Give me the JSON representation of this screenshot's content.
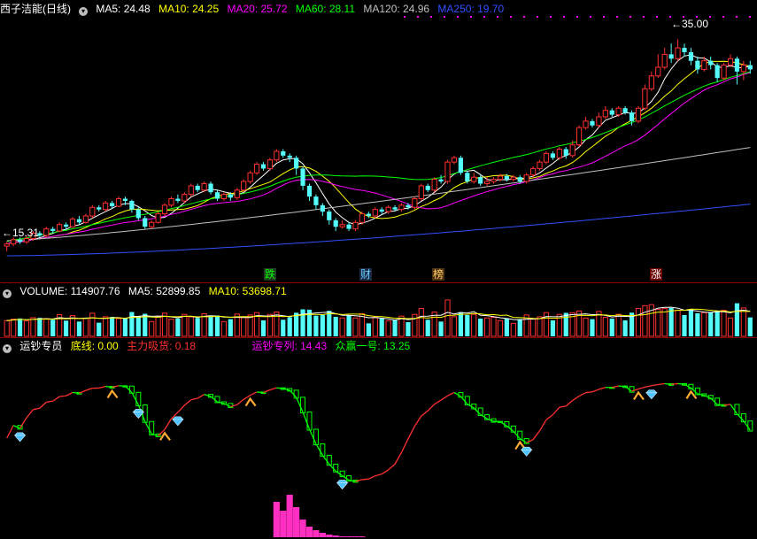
{
  "stock": {
    "name": "西子洁能",
    "period": "(日线)"
  },
  "price_panel": {
    "ma_labels": [
      {
        "text": "MA5: 24.48",
        "color": "#ffffff"
      },
      {
        "text": "MA10: 24.25",
        "color": "#ffff00"
      },
      {
        "text": "MA20: 25.72",
        "color": "#ff00ff"
      },
      {
        "text": "MA60: 28.11",
        "color": "#00ff00"
      },
      {
        "text": "MA120: 24.96",
        "color": "#c0c0c0"
      },
      {
        "text": "MA250: 19.70",
        "color": "#3050ff"
      }
    ],
    "high_label": "35.00",
    "low_label": "15.31",
    "event_tags": [
      {
        "text": "跌",
        "color": "#00ff00",
        "bg": "#1f3a1f"
      },
      {
        "text": "财",
        "color": "#66ccff",
        "bg": "#1c2a44"
      },
      {
        "text": "榜",
        "color": "#ffcc66",
        "bg": "#4a3010"
      },
      {
        "text": "涨",
        "color": "#ffffff",
        "bg": "#6a0000"
      }
    ]
  },
  "volume_panel": {
    "labels": [
      {
        "text": "VOLUME: 114907.76",
        "color": "#ffffff"
      },
      {
        "text": "MA5: 52899.85",
        "color": "#ffffff"
      },
      {
        "text": "MA10: 53698.71",
        "color": "#ffff00"
      }
    ]
  },
  "indicator_panel": {
    "name": "运钞专员",
    "labels": [
      {
        "text": "底线: 0.00",
        "color": "#ffff00"
      },
      {
        "text": "主力吸货: 0.18",
        "color": "#ff3030"
      },
      {
        "text": "运钞专列: 14.43",
        "color": "#ff00ff"
      },
      {
        "text": "众赢一号: 13.25",
        "color": "#00ff00"
      }
    ]
  },
  "colors": {
    "up": "#ff3030",
    "down": "#54fcfc",
    "background": "#000000",
    "separator": "#8b0000"
  },
  "chart_data": {
    "type": "candlestick",
    "candles_approx": [
      [
        15.8,
        16.0,
        15.3,
        16.2
      ],
      [
        16.0,
        16.4,
        15.8,
        16.6
      ],
      [
        16.4,
        16.2,
        16.0,
        16.6
      ],
      [
        16.2,
        16.5,
        16.0,
        16.8
      ],
      [
        16.5,
        17.0,
        16.3,
        17.2
      ],
      [
        17.0,
        16.8,
        16.6,
        17.2
      ],
      [
        16.8,
        17.4,
        16.6,
        17.6
      ],
      [
        17.4,
        17.2,
        17.0,
        17.6
      ],
      [
        17.2,
        17.8,
        17.1,
        18.0
      ],
      [
        17.8,
        17.6,
        17.3,
        18.0
      ],
      [
        17.6,
        18.3,
        17.5,
        18.5
      ],
      [
        18.3,
        18.0,
        17.8,
        18.6
      ],
      [
        18.0,
        18.6,
        17.9,
        18.8
      ],
      [
        18.6,
        19.4,
        18.4,
        19.6
      ],
      [
        19.4,
        19.2,
        19.0,
        19.6
      ],
      [
        19.2,
        19.8,
        19.0,
        20.0
      ],
      [
        19.8,
        19.5,
        19.3,
        20.0
      ],
      [
        19.5,
        20.2,
        19.4,
        20.4
      ],
      [
        20.2,
        20.0,
        19.6,
        20.4
      ],
      [
        20.0,
        19.2,
        18.9,
        20.1
      ],
      [
        19.2,
        18.4,
        18.2,
        19.4
      ],
      [
        18.4,
        17.6,
        17.4,
        18.6
      ],
      [
        17.6,
        18.0,
        17.4,
        18.2
      ],
      [
        18.0,
        18.8,
        17.9,
        19.0
      ],
      [
        18.8,
        19.6,
        18.6,
        19.8
      ],
      [
        19.6,
        20.2,
        19.4,
        20.4
      ],
      [
        20.2,
        20.0,
        19.8,
        20.6
      ],
      [
        20.0,
        20.6,
        19.8,
        20.8
      ],
      [
        20.6,
        21.4,
        20.4,
        21.6
      ],
      [
        21.4,
        21.0,
        20.8,
        21.6
      ],
      [
        21.0,
        21.6,
        20.8,
        21.8
      ],
      [
        21.6,
        20.8,
        20.6,
        21.8
      ],
      [
        20.8,
        20.2,
        20.0,
        21.0
      ],
      [
        20.2,
        20.6,
        20.0,
        20.8
      ],
      [
        20.6,
        20.3,
        20.0,
        20.8
      ],
      [
        20.3,
        21.0,
        20.1,
        21.2
      ],
      [
        21.0,
        21.8,
        20.8,
        22.0
      ],
      [
        21.8,
        22.6,
        21.6,
        22.8
      ],
      [
        22.6,
        23.4,
        22.4,
        23.6
      ],
      [
        23.4,
        23.0,
        22.8,
        23.6
      ],
      [
        23.0,
        23.8,
        22.8,
        24.0
      ],
      [
        23.8,
        24.6,
        23.6,
        24.8
      ],
      [
        24.6,
        24.2,
        24.0,
        24.8
      ],
      [
        24.2,
        24.0,
        23.6,
        24.4
      ],
      [
        24.0,
        23.0,
        22.4,
        24.2
      ],
      [
        23.0,
        21.4,
        21.0,
        23.2
      ],
      [
        21.4,
        20.4,
        20.0,
        21.6
      ],
      [
        20.4,
        19.6,
        19.2,
        20.6
      ],
      [
        19.6,
        19.0,
        18.6,
        19.8
      ],
      [
        19.0,
        18.2,
        17.8,
        19.2
      ],
      [
        18.2,
        17.6,
        17.2,
        18.4
      ],
      [
        17.6,
        17.8,
        17.4,
        18.2
      ],
      [
        17.8,
        17.4,
        17.2,
        18.0
      ],
      [
        17.4,
        18.0,
        17.2,
        18.2
      ],
      [
        18.0,
        18.8,
        17.8,
        19.0
      ],
      [
        18.8,
        18.6,
        18.4,
        19.0
      ],
      [
        18.6,
        19.2,
        18.4,
        19.4
      ],
      [
        19.2,
        19.0,
        18.8,
        19.4
      ],
      [
        19.0,
        19.4,
        18.8,
        19.6
      ],
      [
        19.4,
        19.2,
        19.0,
        19.6
      ],
      [
        19.2,
        19.6,
        19.0,
        19.8
      ],
      [
        19.6,
        19.4,
        19.2,
        19.8
      ],
      [
        19.4,
        20.2,
        19.2,
        20.4
      ],
      [
        20.2,
        21.4,
        20.0,
        21.6
      ],
      [
        21.4,
        21.0,
        20.8,
        21.6
      ],
      [
        21.0,
        22.0,
        20.8,
        22.2
      ],
      [
        22.0,
        21.8,
        21.6,
        22.4
      ],
      [
        21.8,
        23.6,
        21.6,
        23.8
      ],
      [
        23.6,
        24.0,
        23.4,
        24.2
      ],
      [
        24.0,
        22.6,
        22.4,
        24.2
      ],
      [
        22.6,
        21.8,
        21.6,
        22.8
      ],
      [
        21.8,
        22.2,
        21.6,
        22.6
      ],
      [
        22.2,
        21.6,
        21.4,
        22.4
      ],
      [
        21.6,
        21.8,
        21.4,
        22.2
      ],
      [
        21.8,
        22.0,
        21.6,
        22.2
      ],
      [
        22.0,
        22.3,
        21.8,
        22.5
      ],
      [
        22.3,
        22.0,
        21.8,
        22.5
      ],
      [
        22.0,
        22.2,
        21.8,
        22.4
      ],
      [
        22.2,
        21.8,
        21.6,
        22.4
      ],
      [
        21.8,
        22.4,
        21.6,
        22.6
      ],
      [
        22.4,
        23.0,
        22.2,
        23.2
      ],
      [
        23.0,
        23.6,
        22.8,
        23.8
      ],
      [
        23.6,
        24.4,
        23.4,
        24.6
      ],
      [
        24.4,
        24.0,
        23.8,
        24.6
      ],
      [
        24.0,
        24.8,
        23.8,
        25.0
      ],
      [
        24.8,
        24.2,
        23.9,
        25.0
      ],
      [
        24.2,
        25.2,
        24.0,
        25.6
      ],
      [
        25.2,
        26.8,
        25.0,
        27.0
      ],
      [
        26.8,
        27.4,
        26.6,
        27.8
      ],
      [
        27.4,
        27.0,
        26.8,
        27.6
      ],
      [
        27.0,
        27.8,
        26.8,
        28.2
      ],
      [
        27.8,
        28.4,
        27.6,
        28.8
      ],
      [
        28.4,
        28.0,
        27.8,
        28.6
      ],
      [
        28.0,
        28.6,
        27.8,
        28.8
      ],
      [
        28.6,
        28.2,
        28.0,
        28.8
      ],
      [
        28.2,
        27.4,
        27.0,
        28.4
      ],
      [
        27.4,
        28.6,
        27.2,
        28.8
      ],
      [
        28.6,
        30.4,
        28.4,
        30.8
      ],
      [
        30.4,
        31.6,
        30.2,
        32.0
      ],
      [
        31.6,
        32.4,
        31.4,
        33.6
      ],
      [
        32.4,
        33.6,
        32.2,
        34.2
      ],
      [
        33.6,
        33.2,
        32.8,
        34.6
      ],
      [
        33.2,
        34.2,
        33.0,
        35.0
      ],
      [
        34.2,
        33.8,
        33.4,
        34.6
      ],
      [
        33.8,
        33.0,
        32.6,
        34.2
      ],
      [
        33.0,
        32.2,
        31.8,
        33.4
      ],
      [
        32.2,
        33.0,
        32.0,
        33.4
      ],
      [
        33.0,
        32.6,
        32.2,
        33.4
      ],
      [
        32.6,
        31.4,
        31.0,
        32.8
      ],
      [
        31.4,
        32.6,
        31.2,
        32.8
      ],
      [
        32.6,
        33.2,
        32.4,
        33.6
      ],
      [
        33.2,
        32.0,
        30.8,
        33.4
      ],
      [
        32.0,
        32.6,
        31.2,
        33.0
      ],
      [
        32.6,
        32.2,
        31.8,
        33.0
      ]
    ],
    "price_range": [
      14,
      37
    ],
    "volume_range": [
      0,
      135000
    ],
    "ma_series": [
      "MA5",
      "MA10",
      "MA20",
      "MA60",
      "MA120",
      "MA250"
    ]
  }
}
